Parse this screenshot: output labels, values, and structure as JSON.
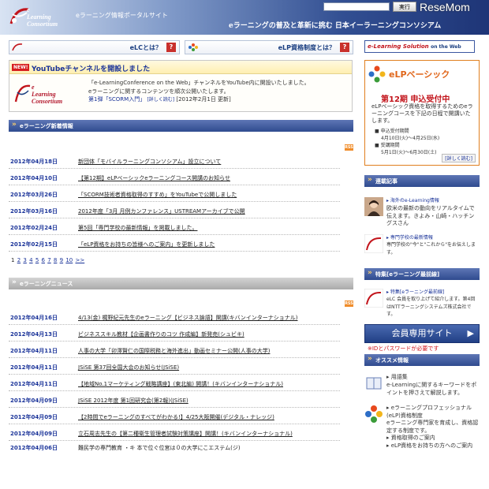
{
  "header": {
    "logo_text": [
      "e",
      "Learning",
      "Consortium"
    ],
    "portal_title": "eラーニング情報ポータルサイト",
    "search_placeholder": "",
    "search_button": "実行",
    "brand": "ReseMom",
    "tagline": "eラーニングの普及と革新に挑む 日本イーラーニングコンソシアム"
  },
  "nav": {
    "elc_label": "eLCとは？",
    "elp_label": "eLP資格制度とは？",
    "question_mark": "?",
    "els_banner_a": "e-Learning",
    "els_banner_b": "Solution",
    "els_banner_c": "on the Web"
  },
  "announcement": {
    "badge": "NEW!",
    "title": "YouTubeチャンネルを開設しました",
    "logo_text": [
      "e",
      "Learning",
      "Consortium"
    ],
    "line1": "「e-LearningConference on the Web」チャンネルをYouTube内に開設いたしました。",
    "line2": "eラーニングに関するコンテンツを順次公開いたします。",
    "line3_link": "第1弾「SCORM入門」",
    "line3_more": "詳しく読む",
    "line3_date": "[2012年2月1日 更新]"
  },
  "whats_new": {
    "heading": "eラーニング新着情報",
    "rss": "RSS",
    "rows": [
      {
        "date": "2012年04月18日",
        "title": "新団体「モバイルラーニングコンソシアム」設立について"
      },
      {
        "date": "2012年04月10日",
        "title": "【第12期】eLPベーシックeラーニングコース開講のお知らせ"
      },
      {
        "date": "2012年03月26日",
        "title": "「SCORM技術者資格取得のすすめ」をYouTubeで公開しました"
      },
      {
        "date": "2012年03月16日",
        "title": "2012年度「3月 月例カンファレンス」USTREAMアーカイブで公開"
      },
      {
        "date": "2012年02月24日",
        "title": "第5回「専門学校の最新情報」を掲載しました。"
      },
      {
        "date": "2012年02月15日",
        "title": "「eLP資格をお持ちの皆様へのご案内」を更新しました"
      }
    ],
    "pager": [
      "1",
      "2",
      "3",
      "4",
      "5",
      "6",
      "7",
      "8",
      "9",
      "10",
      ">>"
    ]
  },
  "elearning_news": {
    "heading": "eラーニングニュース",
    "rss": "RSS",
    "rows": [
      {
        "date": "2012年04月16日",
        "title": "4/13(金) 梶野紀元先生のeラーニング【ビジネス論語】開講(キバンインターナショナル)"
      },
      {
        "date": "2012年04月13日",
        "title": "ビジネススキル教材【企画書作りのコツ 作成編】新発売(シュビキ)"
      },
      {
        "date": "2012年04月11日",
        "title": "人事の大学「卯澤賢仁の国際税務と海外進出」動画セミナー公開(人事の大学)"
      },
      {
        "date": "2012年04月11日",
        "title": "JSiSE 第37回全国大会のお知らせ(JSiSE)"
      },
      {
        "date": "2012年04月11日",
        "title": "【地域No.1マーケティング戦略講座】(東北編) 開講！(キバンインターナショナル)"
      },
      {
        "date": "2012年04月09日",
        "title": "JSiSE 2012年度 第1回研究会(第2報)(JSiSE)"
      },
      {
        "date": "2012年04月09日",
        "title": "【2時間でeラーニングのすべてがわかる!】4/25大阪開催(デジタル・ナレッジ)"
      },
      {
        "date": "2012年04月09日",
        "title": "立石周志先生の【第二種衛生管理者試験対策講座】開講！(キバンインターナショナル)"
      },
      {
        "date": "2012年04月06日",
        "title": "難民学の専門教育 ・キ 本で位ぐ位宮は０の大学にこエステム(ジ)"
      }
    ]
  },
  "elp": {
    "title": "eLPベーシック",
    "subtitle": "第12期 申込受付中",
    "desc": "eLPベーシック資格を取得するためのeラーニングコースを下記の日程で開講いたします。",
    "sched1_label": "■ 申込受付期間",
    "sched1_value": "4月10日(火)〜4月25日(水)",
    "sched2_label": "■ 受講期間",
    "sched2_value": "5月1日(火)〜6月30日(土)",
    "more": "詳しく読む"
  },
  "serial": {
    "heading": "連載記事",
    "item1_title": "海外のe-Learning情報",
    "item1_desc": "欧米の最新の動向をリアルタイムで伝えます。きよみ・山崎・ハッチングスさん",
    "item2_title": "専門学校の最新情報",
    "item2_desc": "専門学校の\"今\"と\"これから\"をお伝えします。"
  },
  "feature": {
    "heading": "特集[eラーニング最前線]",
    "item_title": "特集[eラーニング最前線]",
    "item_desc": "eLC 会員を取り上げて紹介します。第4回はNTTラーニングシステムズ株式会社です。"
  },
  "member": {
    "button": "会員専用サイト",
    "arrow": "▶",
    "note": "※IDとパスワードが必要です"
  },
  "osusume": {
    "heading": "オススメ情報",
    "item1_title": "用語集",
    "item1_desc": "e-Learningに関するキーワードをポイントを押さえて解説します。",
    "item2_title": "eラーニングプロフェッショナル(eLP)資格制度",
    "item2_desc": "eラーニング専門家を育成し、資格認定する制度です。",
    "item2_link1": "資格取得のご案内",
    "item2_link2": "eLP資格をお持ちの方へのご案内"
  }
}
